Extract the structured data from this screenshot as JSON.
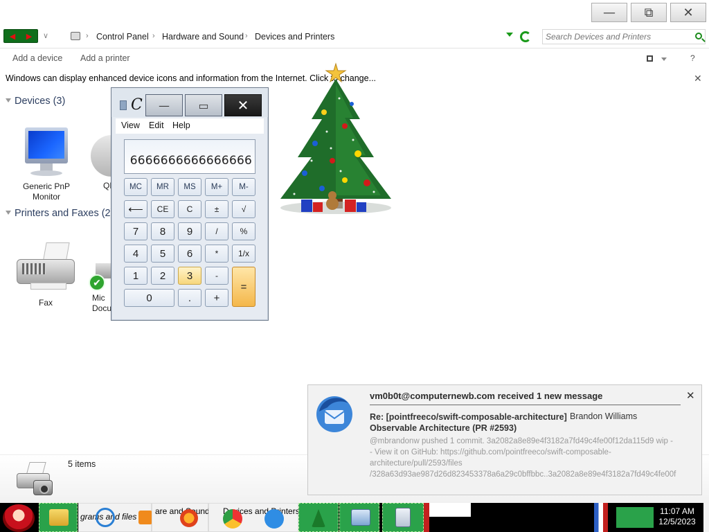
{
  "window": {
    "controls": {
      "minimize": "—",
      "maximize": "⧉",
      "close": "✕"
    }
  },
  "address": {
    "breadcrumbs": [
      "Control Panel",
      "Hardware and Sound",
      "Devices and Printers"
    ],
    "search_placeholder": "Search Devices and Printers"
  },
  "toolbar": {
    "add_device": "Add a device",
    "add_printer": "Add a printer",
    "help": "?"
  },
  "infobar": {
    "text": "Windows can display enhanced device icons and information from the Internet. Click to change...",
    "close": "✕"
  },
  "groups": {
    "devices": {
      "title": "Devices (3)",
      "items": [
        "Generic PnP Monitor",
        "QL"
      ]
    },
    "printers": {
      "title": "Printers and Faxes (2)",
      "items": [
        "Fax",
        "Mic Docu"
      ]
    }
  },
  "statusbar": {
    "count": "5 items"
  },
  "calculator": {
    "title": "C",
    "menu": [
      "View",
      "Edit",
      "Help"
    ],
    "display": "6666666666666666",
    "keys": {
      "row1": [
        "MC",
        "MR",
        "MS",
        "M+",
        "M-"
      ],
      "row2": [
        "⟵",
        "CE",
        "C",
        "±",
        "√"
      ],
      "row3": [
        "7",
        "8",
        "9",
        "/",
        "%"
      ],
      "row4": [
        "4",
        "5",
        "6",
        "*",
        "1/x"
      ],
      "row5": [
        "1",
        "2",
        "3",
        "-"
      ],
      "row6": [
        "0",
        ".",
        "+"
      ],
      "equals": "="
    }
  },
  "notification": {
    "title": "vm0b0t@computernewb.com received 1 new message",
    "subject": "Re: [pointfreeco/swift-composable-architecture] Observable Architecture (PR #2593)",
    "from": "Brandon Williams",
    "body": "@mbrandonw pushed 1 commit. 3a2082a8e89e4f3182a7fd49c4fe00f12da115d9 wip -- View it on GitHub: https://github.com/pointfreeco/swift-composable-architecture/pull/2593/files /328a63d93ae987d26d823453378a6a29c0bffbbc..3a2082a8e89e4f3182a7fd49c4fe00f",
    "close": "✕"
  },
  "taskbar": {
    "explorer_label": "grams and files",
    "control_label": "are and Sound",
    "devices_label": "Devices and Printers",
    "time": "11:07 AM",
    "date": "12/5/2023"
  },
  "colors": {
    "taskbar_bg": "#000000",
    "taskbar_button": "#2aa24a",
    "nav_green": "#0f6e1b"
  }
}
